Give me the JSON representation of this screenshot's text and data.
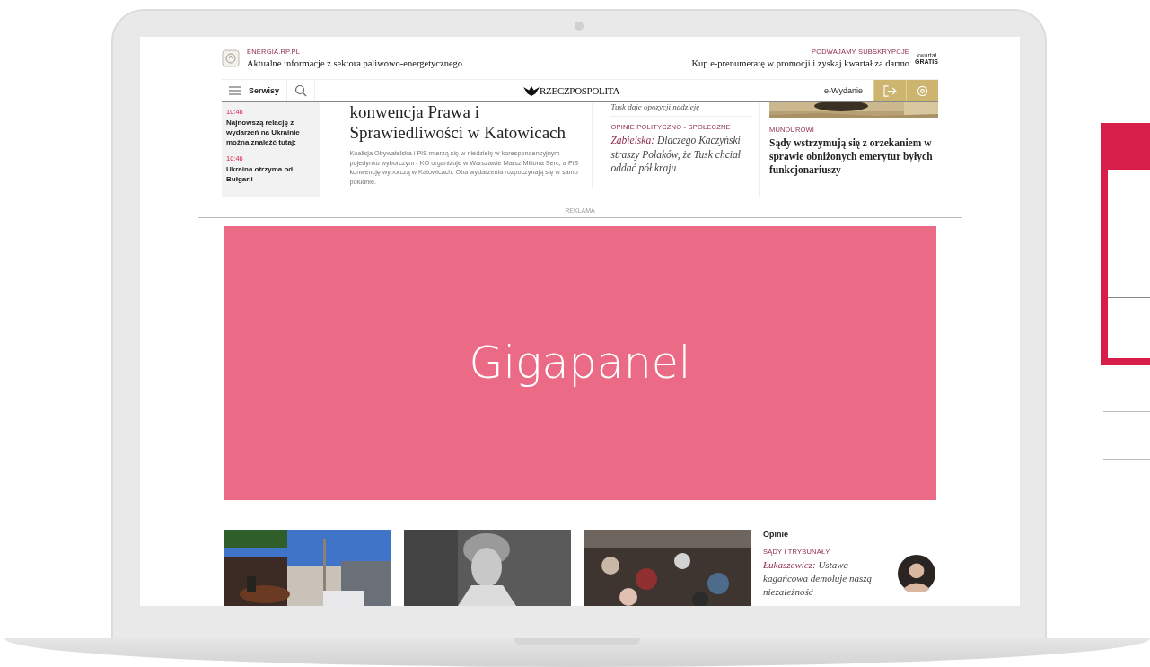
{
  "promo_bar": {
    "left": {
      "kicker": "ENERGIA.RP.PL",
      "text": "Aktualne informacje z sektora paliwowo-energetycznego"
    },
    "right": {
      "kicker": "PODWAJAMY SUBSKRYPCJE",
      "text": "Kup e-prenumeratę w promocji i zyskaj kwartał za darmo",
      "badge_small": "kwartał",
      "badge": "GRATIS"
    }
  },
  "nav": {
    "menu_label": "Serwisy",
    "logo": "RZECZPOSPOLITA",
    "edition_link": "e-Wydanie"
  },
  "live": [
    {
      "time": "10:46",
      "text": "Najnowszą relację z wydarzeń na Ukrainie można znaleźć tutaj:"
    },
    {
      "time": "10:46",
      "text": "Ukraina otrzyma od Bułgarii"
    }
  ],
  "lead": {
    "title": "konwencja Prawa i Sprawiedliwości w Katowicach",
    "lead": "Koalicja Obywatelska i PiS mierzą się w niedzielę w korespondencyjnym pojedynku wyborczym - KO organizuje w Warszawie Marsz Miliona Serc, a PiS konwencję wyborczą w Katowicach. Oba wydarzenia rozpoczynają się w samo południe."
  },
  "column": {
    "prev_title": "Tusk daje opozycji nadzieję",
    "kicker": "OPINIE POLITYCZNO - SPOŁECZNE",
    "author": "Zabielska:",
    "title": "Dlaczego Kaczyński straszy Polaków, że Tusk chciał oddać pół kraju"
  },
  "side": {
    "kicker": "MUNDUROWI",
    "title": "Sądy wstrzymują się z orzekaniem w sprawie obniżonych emerytur byłych funkcjonariuszy"
  },
  "ad": {
    "label": "REKLAMA",
    "text": "Gigapanel"
  },
  "opinions": {
    "heading": "Opinie",
    "kicker": "SĄDY I TRYBUNAŁY",
    "author": "Łukaszewicz:",
    "title": "Ustawa kagańcowa demoluje naszą niezależność"
  }
}
